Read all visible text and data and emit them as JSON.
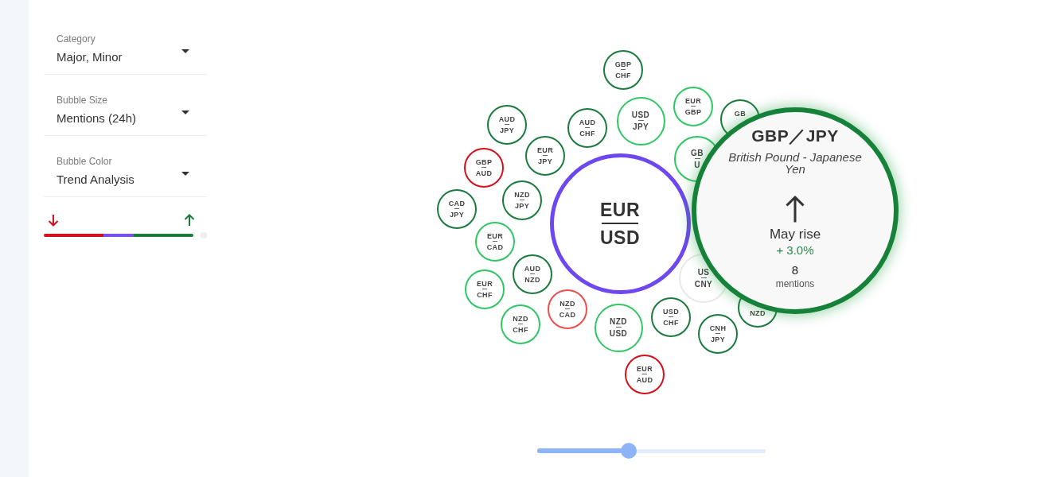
{
  "filters": [
    {
      "label": "Category",
      "value": "Major, Minor"
    },
    {
      "label": "Bubble Size",
      "value": "Mentions (24h)"
    },
    {
      "label": "Bubble Color",
      "value": "Trend Analysis"
    }
  ],
  "bubbles": [
    {
      "base": "GBP",
      "quote": "CHF",
      "color": "#1b7a3e"
    },
    {
      "base": "AUD",
      "quote": "JPY",
      "color": "#1b7a3e"
    },
    {
      "base": "AUD",
      "quote": "CHF",
      "color": "#1b7a3e"
    },
    {
      "base": "USD",
      "quote": "JPY",
      "color": "#2fc764"
    },
    {
      "base": "EUR",
      "quote": "GBP",
      "color": "#2fc764"
    },
    {
      "base": "GB",
      "color": "#1b7a3e"
    },
    {
      "base": "GBP",
      "quote": "AUD",
      "color": "#d4101b"
    },
    {
      "base": "EUR",
      "quote": "JPY",
      "color": "#1b7a3e"
    },
    {
      "base": "CAD",
      "quote": "JPY",
      "color": "#1b7a3e"
    },
    {
      "base": "NZD",
      "quote": "JPY",
      "color": "#1b7a3e"
    },
    {
      "base": "EUR",
      "quote": "CAD",
      "color": "#2fc764"
    },
    {
      "base": "EUR",
      "quote": "CHF",
      "color": "#2fc764"
    },
    {
      "base": "AUD",
      "quote": "NZD",
      "color": "#1b7a3e"
    },
    {
      "base": "EUR",
      "quote": "USD",
      "color": "#6d47ef"
    },
    {
      "base": "GB",
      "quote": "U",
      "color": "#2fc764"
    },
    {
      "base": "US",
      "quote": "CNY",
      "color": "#e9e9e9"
    },
    {
      "base": "NZD",
      "quote": "CHF",
      "color": "#2fc764"
    },
    {
      "base": "NZD",
      "quote": "CAD",
      "color": "#ee4d4d"
    },
    {
      "base": "NZD",
      "quote": "USD",
      "color": "#2fc764"
    },
    {
      "base": "USD",
      "quote": "CHF",
      "color": "#1b7a3e"
    },
    {
      "base": "CNH",
      "quote": "JPY",
      "color": "#1b7a3e"
    },
    {
      "quote": "NZD",
      "color": "#1b7a3e"
    },
    {
      "base": "EUR",
      "quote": "AUD",
      "color": "#d4101b"
    }
  ],
  "detail_card": {
    "title": "GBP／JPY",
    "name": "British Pound - Japanese Yen",
    "rising": true,
    "trend_label": "May rise",
    "change": "+ 3.0%",
    "mentions": "8",
    "mentions_label": "mentions"
  },
  "time_slider": {
    "level": 0.4
  }
}
